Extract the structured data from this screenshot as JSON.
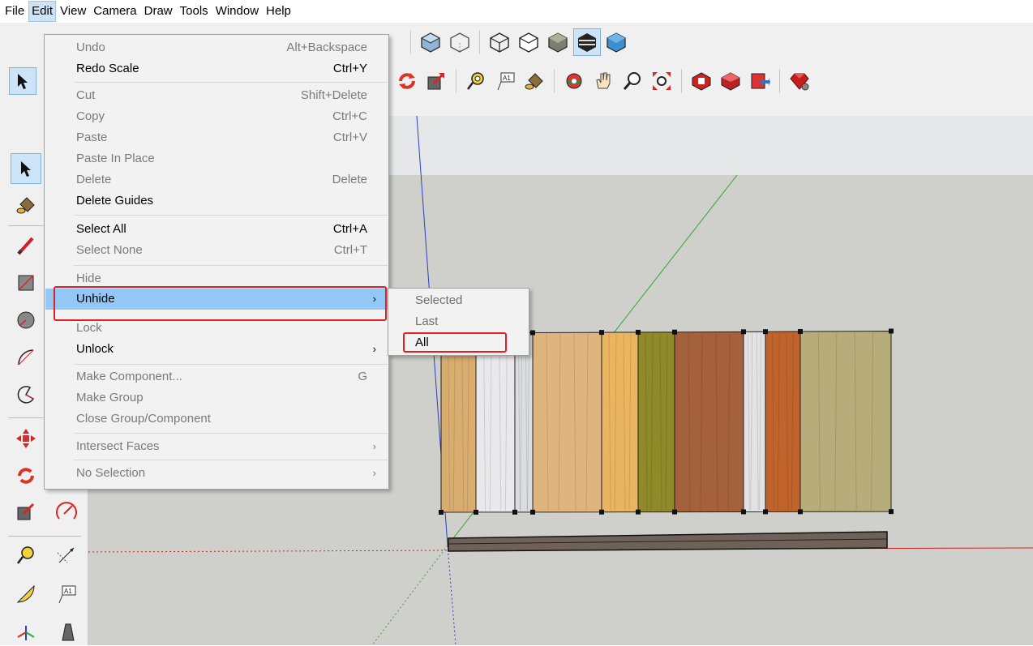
{
  "menubar": {
    "items": [
      "File",
      "Edit",
      "View",
      "Camera",
      "Draw",
      "Tools",
      "Window",
      "Help"
    ],
    "active": "Edit"
  },
  "edit_menu": {
    "undo": {
      "label": "Undo",
      "shortcut": "Alt+Backspace",
      "enabled": false
    },
    "redo": {
      "label": "Redo Scale",
      "shortcut": "Ctrl+Y",
      "enabled": true
    },
    "cut": {
      "label": "Cut",
      "shortcut": "Shift+Delete",
      "enabled": false
    },
    "copy": {
      "label": "Copy",
      "shortcut": "Ctrl+C",
      "enabled": false
    },
    "paste": {
      "label": "Paste",
      "shortcut": "Ctrl+V",
      "enabled": false
    },
    "paste_in_place": {
      "label": "Paste In Place",
      "enabled": false
    },
    "delete": {
      "label": "Delete",
      "shortcut": "Delete",
      "enabled": false
    },
    "delete_guides": {
      "label": "Delete Guides",
      "enabled": true
    },
    "select_all": {
      "label": "Select All",
      "shortcut": "Ctrl+A",
      "enabled": true
    },
    "select_none": {
      "label": "Select None",
      "shortcut": "Ctrl+T",
      "enabled": false
    },
    "hide": {
      "label": "Hide",
      "enabled": false
    },
    "unhide": {
      "label": "Unhide",
      "enabled": true,
      "highlighted": true
    },
    "lock": {
      "label": "Lock",
      "enabled": false
    },
    "unlock": {
      "label": "Unlock",
      "enabled": true
    },
    "make_component": {
      "label": "Make Component...",
      "shortcut": "G",
      "enabled": false
    },
    "make_group": {
      "label": "Make Group",
      "enabled": false
    },
    "close_group": {
      "label": "Close Group/Component",
      "enabled": false
    },
    "intersect_faces": {
      "label": "Intersect Faces",
      "enabled": false
    },
    "no_selection": {
      "label": "No Selection",
      "enabled": false
    },
    "submenu_arrow": "›"
  },
  "unhide_submenu": {
    "selected": {
      "label": "Selected",
      "enabled": false
    },
    "last": {
      "label": "Last",
      "enabled": false
    },
    "all": {
      "label": "All",
      "enabled": true
    }
  },
  "toolbar": {
    "text_tool_label": "A1"
  },
  "left_toolbar": {
    "text_tool_label": "A1"
  },
  "colors": {
    "menu_highlight": "#93c7f5",
    "annotation_red": "#e02020",
    "sky": "#e6e7e8",
    "ground": "#cfcfcb",
    "axis_blue": "#2b3fc7",
    "axis_green": "#2fa82f",
    "axis_red": "#d02020"
  },
  "panels": [
    {
      "texture": "light-oak",
      "color": "#d9ad6f"
    },
    {
      "texture": "white-marble",
      "color": "#e9e9eb"
    },
    {
      "texture": "white-marble",
      "color": "#dcdde0"
    },
    {
      "texture": "parquet-oak",
      "color": "#dfb47f"
    },
    {
      "texture": "cork",
      "color": "#e9b560"
    },
    {
      "texture": "olive-wood",
      "color": "#8f8a2a"
    },
    {
      "texture": "walnut",
      "color": "#a4613b"
    },
    {
      "texture": "white-marble",
      "color": "#e3e3e6"
    },
    {
      "texture": "cherry",
      "color": "#c0642c"
    },
    {
      "texture": "weathered-wood",
      "color": "#b6ad7b"
    }
  ]
}
